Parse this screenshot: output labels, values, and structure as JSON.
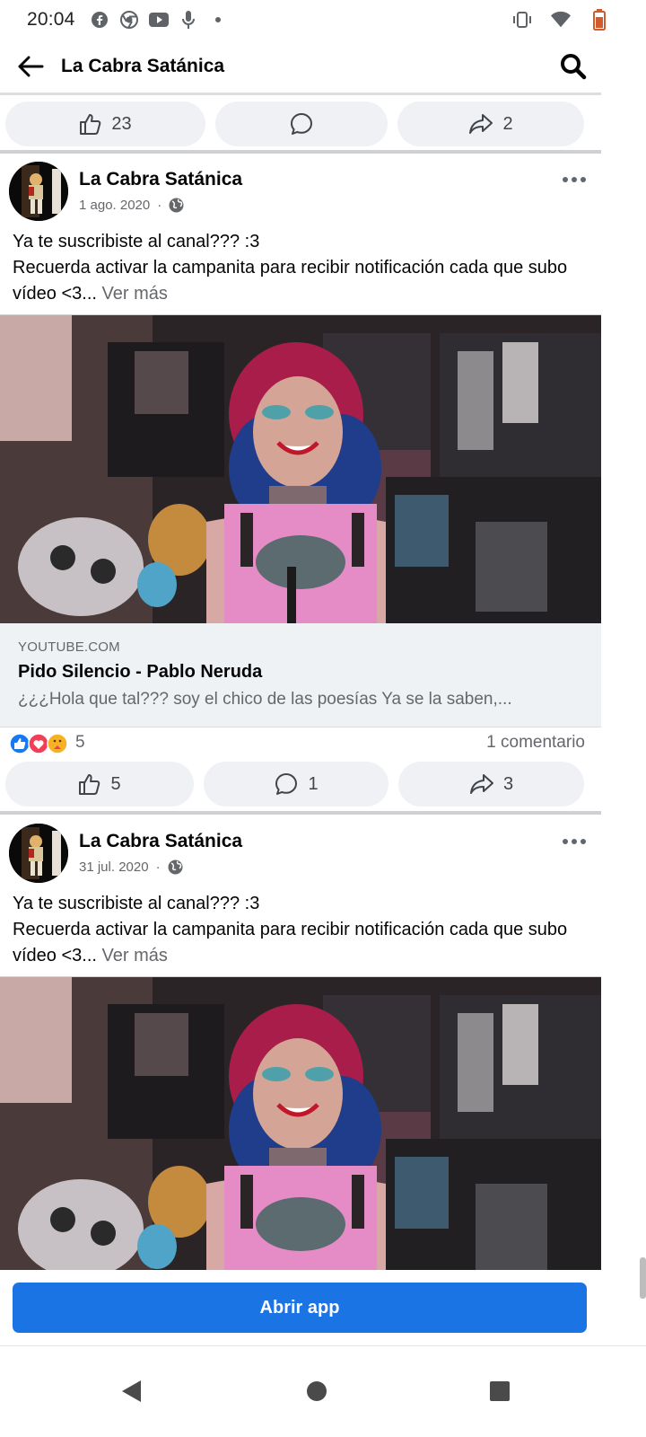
{
  "status": {
    "time": "20:04",
    "left_icons": [
      "facebook-icon",
      "chrome-icon",
      "youtube-icon",
      "mic-icon",
      "dot-icon"
    ],
    "right_icons": [
      "vibrate-icon",
      "wifi-icon",
      "battery-icon"
    ]
  },
  "header": {
    "title": "La Cabra Satánica"
  },
  "top_actions": {
    "like_count": "23",
    "share_count": "2"
  },
  "posts": [
    {
      "author": "La Cabra Satánica",
      "date": "1 ago. 2020",
      "separator": "·",
      "text_line1": "Ya te suscribiste al canal??? :3",
      "text_line2": "Recuerda activar la campanita para recibir notificación cada que subo vídeo <3...",
      "see_more": "Ver más",
      "link": {
        "domain": "YOUTUBE.COM",
        "title": "Pido Silencio - Pablo Neruda",
        "description": "¿¿¿Hola que tal??? soy el chico de las poesías Ya se la saben,..."
      },
      "reaction_count": "5",
      "comment_text": "1 comentario",
      "like_count": "5",
      "comment_count": "1",
      "share_count": "3"
    },
    {
      "author": "La Cabra Satánica",
      "date": "31 jul. 2020",
      "separator": "·",
      "text_line1": "Ya te suscribiste al canal??? :3",
      "text_line2": "Recuerda activar la campanita para recibir notificación cada que subo vídeo <3...",
      "see_more": "Ver más"
    }
  ],
  "cta": {
    "label": "Abrir app"
  },
  "colors": {
    "accent": "#1b74e4",
    "pill": "#eff1f4",
    "secondary_text": "#65676b"
  }
}
